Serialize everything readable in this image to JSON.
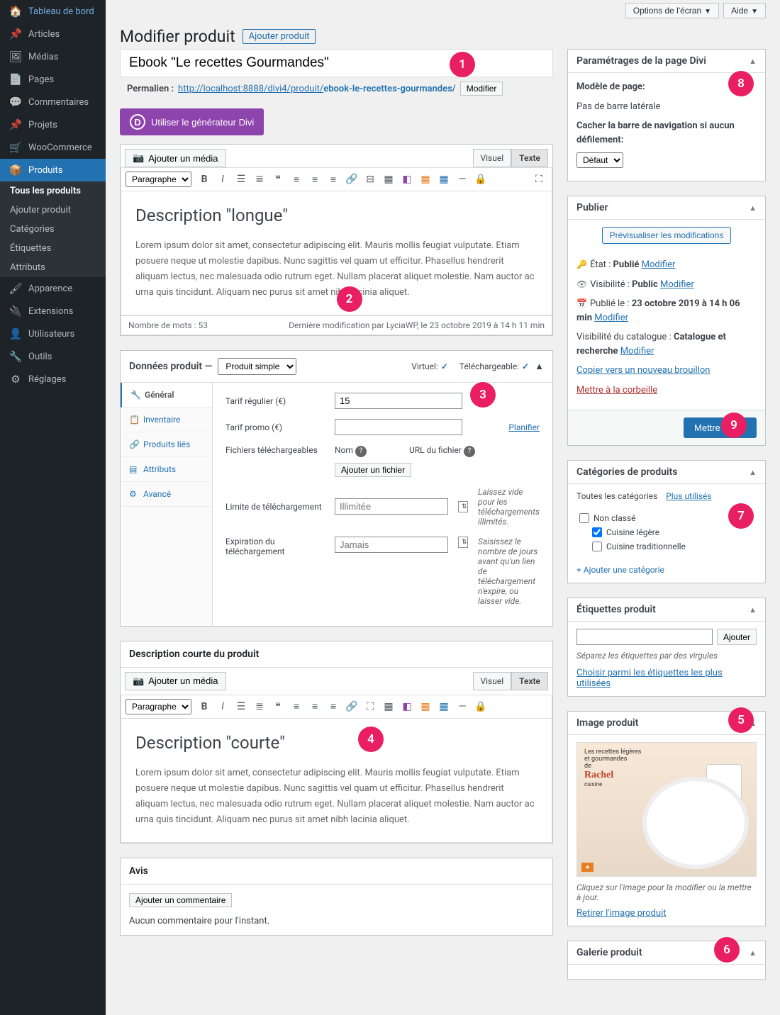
{
  "topbar": {
    "screen_options": "Options de l'écran",
    "help": "Aide"
  },
  "sidebar": {
    "dashboard": "Tableau de bord",
    "posts": "Articles",
    "media": "Médias",
    "pages": "Pages",
    "comments": "Commentaires",
    "projects": "Projets",
    "woocommerce": "WooCommerce",
    "products": "Produits",
    "appearance": "Apparence",
    "plugins": "Extensions",
    "users": "Utilisateurs",
    "tools": "Outils",
    "settings": "Réglages",
    "sub_all": "Tous les produits",
    "sub_add": "Ajouter produit",
    "sub_cats": "Catégories",
    "sub_tags": "Étiquettes",
    "sub_attrs": "Attributs"
  },
  "header": {
    "title": "Modifier produit",
    "add_new": "Ajouter produit"
  },
  "title_field": {
    "value": "Ebook \"Le recettes Gourmandes\""
  },
  "permalink": {
    "label": "Permalien :",
    "base": "http://localhost:8888/divi4/produit/",
    "slug": "ebook-le-recettes-gourmandes/",
    "edit": "Modifier"
  },
  "divi_btn": "Utiliser le générateur Divi",
  "editor": {
    "add_media": "Ajouter un média",
    "visual_tab": "Visuel",
    "text_tab": "Texte",
    "format_select": "Paragraphe",
    "long_heading": "Description \"longue\"",
    "lorem": "Lorem ipsum dolor sit amet, consectetur adipiscing elit. Mauris mollis feugiat vulputate. Etiam posuere neque ut molestie dapibus. Nunc sagittis vel quam ut efficitur. Phasellus hendrerit aliquam lectus, nec malesuada odio rutrum eget. Nullam placerat aliquet molestie. Nam auctor ac urna quis tincidunt. Aliquam nec purus sit amet nibh lacinia aliquet.",
    "word_count": "Nombre de mots : 53",
    "last_edit": "Dernière modification par LyciaWP, le 23 octobre 2019 à 14 h 11 min"
  },
  "product_data": {
    "title": "Données produit —",
    "type_select": "Produit simple",
    "virtual_label": "Virtuel:",
    "downloadable_label": "Téléchargeable:",
    "tab_general": "Général",
    "tab_inventory": "Inventaire",
    "tab_linked": "Produits liés",
    "tab_attrs": "Attributs",
    "tab_advanced": "Avancé",
    "regular_price_label": "Tarif régulier (€)",
    "regular_price_value": "15",
    "sale_price_label": "Tarif promo (€)",
    "schedule": "Planifier",
    "dl_files_label": "Fichiers téléchargeables",
    "dl_name": "Nom",
    "dl_url": "URL du fichier",
    "add_file": "Ajouter un fichier",
    "dl_limit_label": "Limite de téléchargement",
    "dl_limit_value": "Illimitée",
    "dl_limit_hint": "Laissez vide pour les téléchargements illimités.",
    "dl_expiry_label": "Expiration du téléchargement",
    "dl_expiry_value": "Jamais",
    "dl_expiry_hint": "Saisissez le nombre de jours avant qu'un lien de téléchargement n'expire, ou laisser vide."
  },
  "short_desc": {
    "title": "Description courte du produit",
    "heading": "Description \"courte\""
  },
  "reviews": {
    "title": "Avis",
    "add_comment": "Ajouter un commentaire",
    "none": "Aucun commentaire pour l'instant."
  },
  "divi_settings": {
    "title": "Paramétrages de la page Divi",
    "model_label": "Modèle de page:",
    "model_value": "Pas de barre latérale",
    "hide_nav_label": "Cacher la barre de navigation si aucun défilement:",
    "hide_nav_select": "Défaut"
  },
  "publish": {
    "title": "Publier",
    "preview": "Prévisualiser les modifications",
    "status_label": "État :",
    "status_value": "Publié",
    "visibility_label": "Visibilité :",
    "visibility_value": "Public",
    "published_label": "Publié le :",
    "published_value": "23 octobre 2019 à 14 h 06 min",
    "catalog_label": "Visibilité du catalogue :",
    "catalog_value": "Catalogue et recherche",
    "modify": "Modifier",
    "copy_draft": "Copier vers un nouveau brouillon",
    "trash": "Mettre à la corbeille",
    "update": "Mettre à jour"
  },
  "categories": {
    "title": "Catégories de produits",
    "all_tab": "Toutes les catégories",
    "used_tab": "Plus utilisés",
    "cat_unclass": "Non classé",
    "cat_light": "Cuisine légère",
    "cat_trad": "Cuisine traditionnelle",
    "add": "+ Ajouter une catégorie"
  },
  "tags": {
    "title": "Étiquettes produit",
    "add_btn": "Ajouter",
    "hint": "Séparez les étiquettes par des virgules",
    "choose": "Choisir parmi les étiquettes les plus utilisées"
  },
  "image": {
    "title": "Image produit",
    "book_line1": "Les recettes légères",
    "book_line2": "et gourmandes",
    "book_line3": "de",
    "book_author": "Rachel",
    "book_sub": "cuisine",
    "click_hint": "Cliquez sur l'image pour la modifier ou la mettre à jour.",
    "remove": "Retirer l'image produit"
  },
  "gallery": {
    "title": "Galerie produit"
  },
  "badges": {
    "b1": "1",
    "b2": "2",
    "b3": "3",
    "b4": "4",
    "b5": "5",
    "b6": "6",
    "b7": "7",
    "b8": "8",
    "b9": "9"
  }
}
